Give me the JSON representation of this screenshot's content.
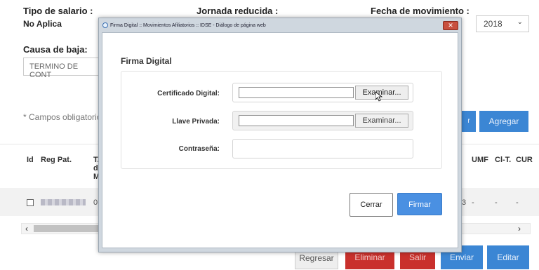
{
  "page": {
    "tipo_salario_label": "Tipo de salario :",
    "tipo_salario_value": "No Aplica",
    "jornada_label": "Jornada reducida :",
    "fecha_label": "Fecha de movimiento :",
    "year_value": "2018",
    "causa_label": "Causa de baja:",
    "causa_value": "TERMINO DE CONT",
    "campos_note": "* Campos obligatorio",
    "agregar_label": "Agregar",
    "columns": [
      "Id",
      "Reg Pat.",
      "T.",
      "UMF",
      "Cl-T.",
      "CUR"
    ],
    "col_t_extra": [
      "d",
      "M"
    ],
    "row_values": [
      "0",
      "3",
      "-",
      "-",
      "-"
    ],
    "buttons": {
      "regresar": "Regresar",
      "eliminar": "Eliminar",
      "salir": "Salir",
      "enviar": "Enviar",
      "editar": "Editar"
    }
  },
  "dialog": {
    "window_title": "Firma Digital :: Movimientos Afiliatorios :: IDSE - Diálogo de página web",
    "close_glyph": "✕",
    "heading": "Firma Digital",
    "fields": {
      "certificado_label": "Certificado Digital:",
      "llave_label": "Llave Privada:",
      "contrasena_label": "Contraseña:",
      "examinar_label": "Examinar..."
    },
    "cerrar_label": "Cerrar",
    "firmar_label": "Firmar"
  }
}
